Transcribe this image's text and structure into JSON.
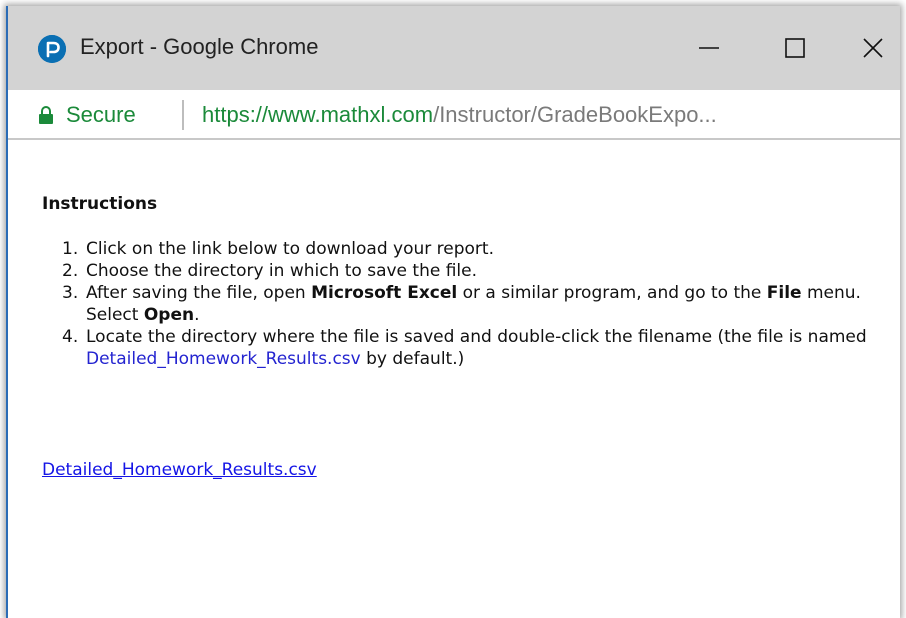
{
  "window": {
    "title": "Export - Google Chrome",
    "app_icon": "pearson-p-icon",
    "controls": {
      "minimize_icon": "minimize-icon",
      "maximize_icon": "maximize-icon",
      "close_icon": "close-icon"
    }
  },
  "address_bar": {
    "security_label": "Secure",
    "url_host": "https://www.mathxl.com",
    "url_path": "/Instructor/GradeBookExpo..."
  },
  "content": {
    "heading": "Instructions",
    "steps": [
      {
        "num": "1.",
        "text": "Click on the link below to download your report."
      },
      {
        "num": "2.",
        "text": "Choose the directory in which to save the file."
      },
      {
        "num": "3.",
        "parts": [
          "After saving the file, open ",
          "Microsoft Excel",
          " or a similar program, and go to the ",
          "File",
          " menu. Select ",
          "Open",
          "."
        ]
      },
      {
        "num": "4.",
        "parts": [
          "Locate the directory where the file is saved and double-click the filename (the file is named ",
          "Detailed_Homework_Results.csv",
          " by default.)"
        ]
      }
    ],
    "download_link": "Detailed_Homework_Results.csv"
  },
  "colors": {
    "titlebar": "#d3d3d3",
    "secure_green": "#1b8a3a",
    "link_blue": "#1414e6",
    "icon_blue": "#0a6fb3"
  }
}
